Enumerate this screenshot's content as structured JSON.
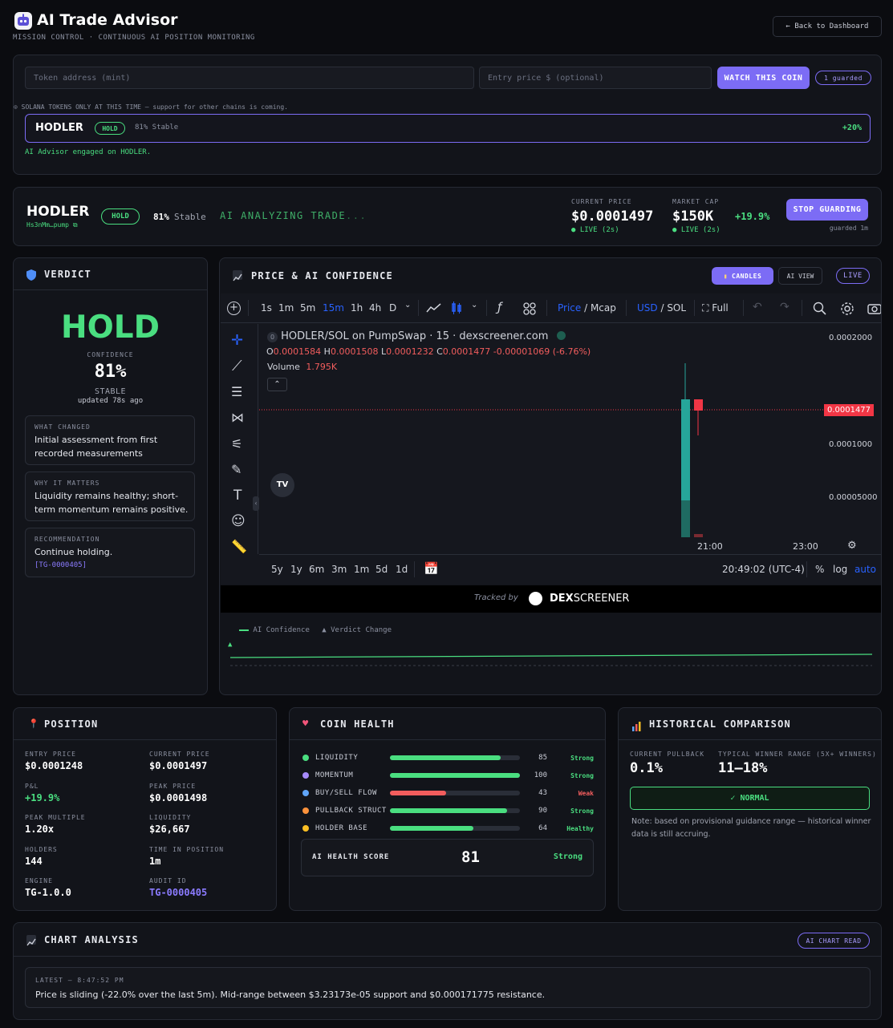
{
  "header": {
    "title": "AI Trade Advisor",
    "subtitle": "MISSION CONTROL · CONTINUOUS AI POSITION MONITORING",
    "back_label": "← Back to Dashboard"
  },
  "watch": {
    "token_placeholder": "Token address (mint)",
    "price_placeholder": "Entry price $ (optional)",
    "watch_button": "WATCH THIS COIN",
    "guarded_badge": "1 guarded",
    "notice": "SOLANA TOKENS ONLY AT THIS TIME — support for other chains is coming.",
    "item": {
      "name": "HODLER",
      "verdict": "HOLD",
      "stability": "81% Stable",
      "change": "+20%"
    },
    "engaged": "AI Advisor engaged on HODLER."
  },
  "summary": {
    "name": "HODLER",
    "address": "Hs3nMm…pump",
    "verdict": "HOLD",
    "pct": "81%",
    "stable": "Stable",
    "analyzing": "AI ANALYZING TRADE",
    "ellipsis": "...",
    "current_price_label": "CURRENT PRICE",
    "current_price": "$0.0001497",
    "price_live": "LIVE (2s)",
    "market_cap_label": "MARKET CAP",
    "market_cap": "$150K",
    "mcap_live": "LIVE (2s)",
    "change": "+19.9%",
    "stop_button": "STOP GUARDING",
    "guarded_time": "guarded 1m"
  },
  "verdict": {
    "title": "VERDICT",
    "value": "HOLD",
    "confidence_label": "CONFIDENCE",
    "confidence": "81%",
    "stability": "STABLE",
    "updated": "updated 78s ago",
    "cards": [
      {
        "label": "WHAT CHANGED",
        "text": "Initial assessment from first recorded measurements"
      },
      {
        "label": "WHY IT MATTERS",
        "text": "Liquidity remains healthy; short-term momentum remains positive."
      },
      {
        "label": "RECOMMENDATION",
        "text": "Continue holding.",
        "ref": "[TG-0000405]"
      }
    ]
  },
  "chart_panel": {
    "title": "PRICE & AI CONFIDENCE",
    "candles_btn": "CANDLES",
    "ai_view_btn": "AI VIEW",
    "live_btn": "LIVE",
    "toolbar": {
      "intervals": [
        "1s",
        "1m",
        "5m",
        "15m",
        "1h",
        "4h",
        "D"
      ],
      "active_interval": "15m",
      "price": "Price",
      "mcap": "Mcap",
      "usd": "USD",
      "sol": "SOL",
      "full": "Full"
    },
    "legend": {
      "title": "HODLER/SOL on PumpSwap · 15 · dexscreener.com",
      "o_label": "O",
      "o_val": "0.0001584",
      "h_label": "H",
      "h_val": "0.0001508",
      "l_label": "L",
      "l_val": "0.0001232",
      "c_label": "C",
      "c_val": "0.0001477",
      "diff": "-0.00001069 (-6.76%)",
      "volume_label": "Volume",
      "volume_val": "1.795K"
    },
    "price_axis": [
      "0.0002000",
      "0.0001000",
      "0.00005000"
    ],
    "last_price": "0.0001477",
    "time_axis": [
      "21:00",
      "23:00"
    ],
    "ranges": [
      "5y",
      "1y",
      "6m",
      "3m",
      "1m",
      "5d",
      "1d"
    ],
    "clock": "20:49:02 (UTC-4)",
    "pct_btn": "%",
    "log_btn": "log",
    "auto_btn": "auto",
    "tracked_by": "Tracked by",
    "dex_brand_1": "DEX",
    "dex_brand_2": "SCREENER",
    "confidence_legend": "AI Confidence",
    "verdict_change_legend": "Verdict Change",
    "accent": "#4ade80"
  },
  "position": {
    "title": "POSITION",
    "entry_price_label": "ENTRY PRICE",
    "entry_price": "$0.0001248",
    "current_price_label": "CURRENT PRICE",
    "current_price": "$0.0001497",
    "pnl_label": "P&L",
    "pnl": "+19.9%",
    "peak_price_label": "PEAK PRICE",
    "peak_price": "$0.0001498",
    "peak_multiple_label": "PEAK MULTIPLE",
    "peak_multiple": "1.20x",
    "liquidity_label": "LIQUIDITY",
    "liquidity": "$26,667",
    "holders_label": "HOLDERS",
    "holders": "144",
    "time_label": "TIME IN POSITION",
    "time": "1m",
    "engine_label": "ENGINE",
    "engine": "TG-1.0.0",
    "audit_label": "AUDIT ID",
    "audit": "TG-0000405"
  },
  "health": {
    "title": "COIN HEALTH",
    "rows": [
      {
        "label": "LIQUIDITY",
        "value": "85",
        "status": "Strong",
        "fill": 0.85,
        "dot": "#4ade80",
        "bar": "#4ade80",
        "status_color": "#4ade80"
      },
      {
        "label": "MOMENTUM",
        "value": "100",
        "status": "Strong",
        "fill": 1.0,
        "dot": "#a78bfa",
        "bar": "#4ade80",
        "status_color": "#4ade80"
      },
      {
        "label": "BUY/SELL FLOW",
        "value": "43",
        "status": "Weak",
        "fill": 0.43,
        "dot": "#60a5fa",
        "bar": "#f25d5d",
        "status_color": "#f25d5d"
      },
      {
        "label": "PULLBACK STRUCT",
        "value": "90",
        "status": "Strong",
        "fill": 0.9,
        "dot": "#fb923c",
        "bar": "#4ade80",
        "status_color": "#4ade80"
      },
      {
        "label": "HOLDER BASE",
        "value": "64",
        "status": "Healthy",
        "fill": 0.64,
        "dot": "#fbbf24",
        "bar": "#4ade80",
        "status_color": "#4ade80"
      }
    ],
    "score_label": "AI HEALTH SCORE",
    "score": "81",
    "score_status": "Strong"
  },
  "historical": {
    "title": "HISTORICAL COMPARISON",
    "pullback_label": "CURRENT PULLBACK",
    "pullback": "0.1%",
    "range_label": "TYPICAL WINNER RANGE (5X+ WINNERS)",
    "range": "11–18%",
    "status": "✓ NORMAL",
    "note": "Note: based on provisional guidance range — historical winner data is still accruing."
  },
  "analysis": {
    "title": "CHART ANALYSIS",
    "badge": "AI CHART READ",
    "latest_label": "LATEST — 8:47:52 PM",
    "text": "Price is sliding (-22.0% over the last 5m). Mid-range between $3.23173e-05 support and $0.000171775 resistance."
  }
}
